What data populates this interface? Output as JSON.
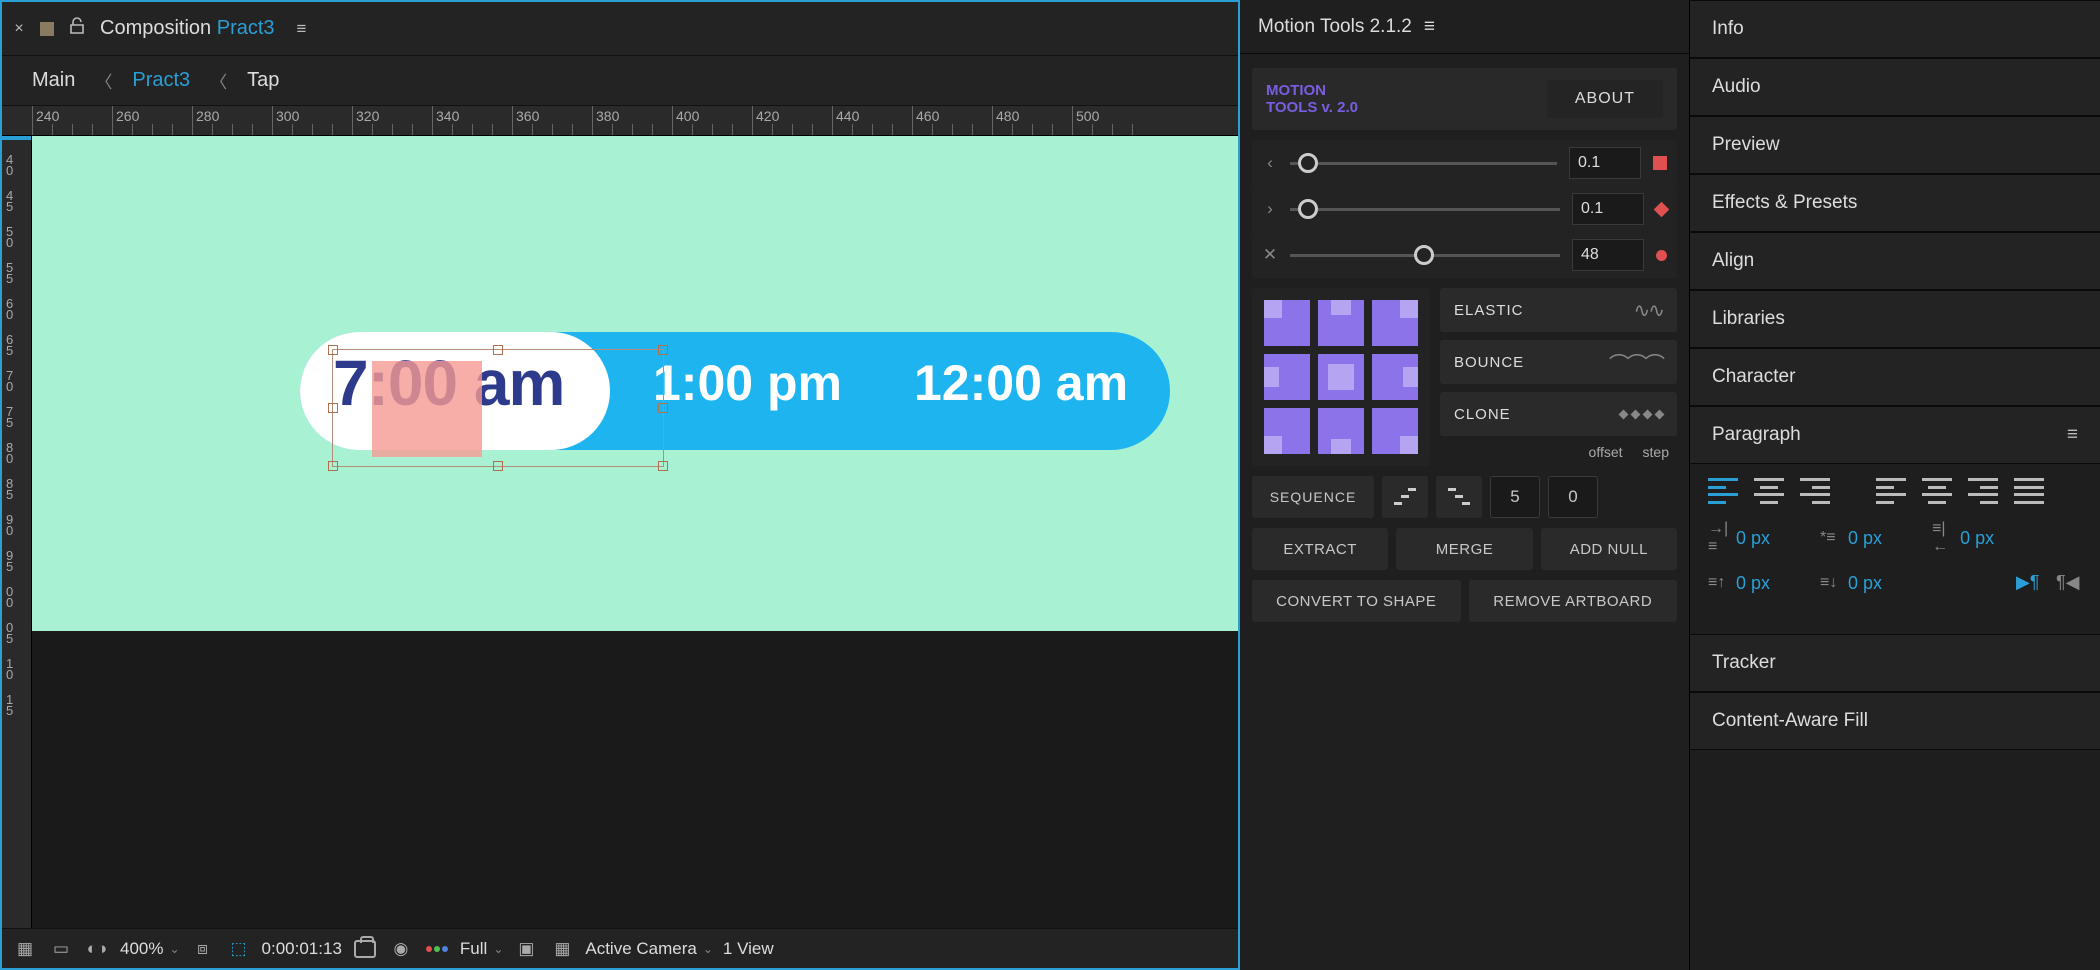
{
  "comp": {
    "title_prefix": "Composition",
    "title_name": "Pract3",
    "tab_close": "×"
  },
  "breadcrumb": {
    "items": [
      "Main",
      "Pract3",
      "Tap"
    ],
    "active_index": 1
  },
  "ruler_h": {
    "start": 240,
    "step": 20,
    "count": 14
  },
  "canvas": {
    "pill": {
      "text1": "7:00 am",
      "text2": "1:00 pm",
      "text3": "12:00 am"
    }
  },
  "footer": {
    "zoom": "400%",
    "time": "0:00:01:13",
    "resolution": "Full",
    "camera": "Active Camera",
    "views": "1 View"
  },
  "motion_tools": {
    "panel_title": "Motion Tools 2.1.2",
    "logo_line1": "MOTION",
    "logo_line2": "TOOLS v. 2.0",
    "about": "ABOUT",
    "sliders": [
      {
        "arrow": "‹",
        "value": "0.1",
        "knob_pct": 3,
        "mark": "sq"
      },
      {
        "arrow": "›",
        "value": "0.1",
        "knob_pct": 3,
        "mark": "diam"
      },
      {
        "arrow": "✕",
        "value": "48",
        "knob_pct": 46,
        "mark": "circ"
      }
    ],
    "elastic": "ELASTIC",
    "bounce": "BOUNCE",
    "clone": "CLONE",
    "offset_label": "offset",
    "step_label": "step",
    "sequence": "SEQUENCE",
    "seq_offset": "5",
    "seq_step": "0",
    "extract": "EXTRACT",
    "merge": "MERGE",
    "add_null": "ADD NULL",
    "convert": "CONVERT TO SHAPE",
    "remove_ab": "REMOVE ARTBOARD"
  },
  "right_panels": {
    "info": "Info",
    "audio": "Audio",
    "preview": "Preview",
    "effects": "Effects & Presets",
    "align": "Align",
    "libraries": "Libraries",
    "character": "Character",
    "paragraph": "Paragraph",
    "tracker": "Tracker",
    "content_aware": "Content-Aware Fill"
  },
  "paragraph": {
    "indents": {
      "left": "0 px",
      "right": "0 px",
      "first_line": "0 px",
      "space_before": "0 px",
      "space_after": "0 px"
    }
  }
}
